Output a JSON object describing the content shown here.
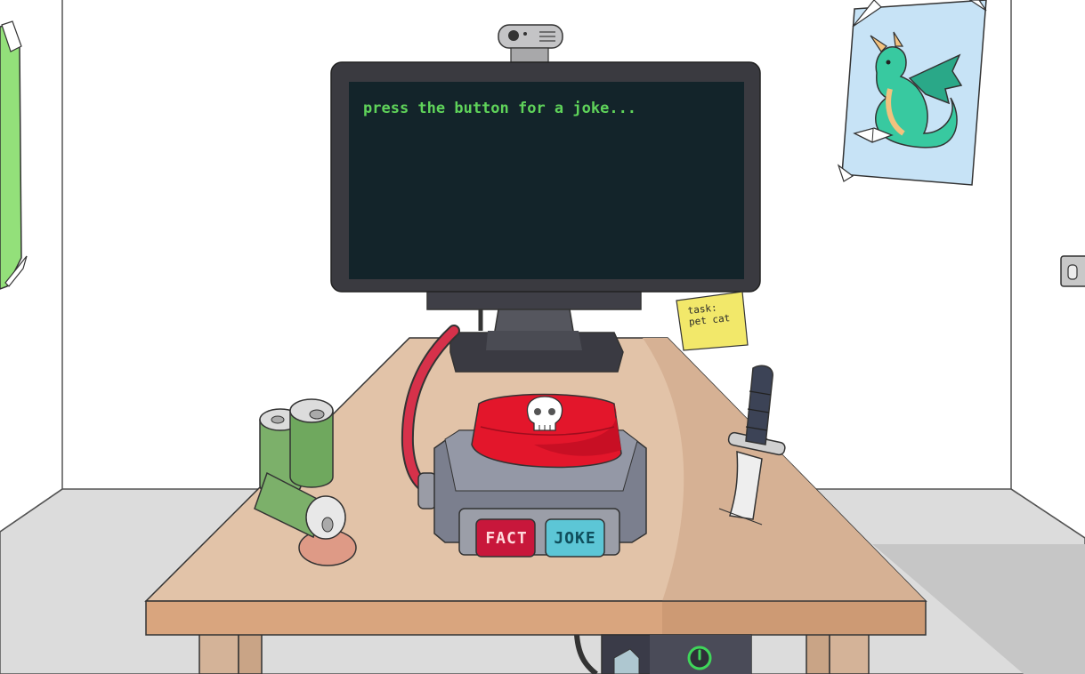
{
  "monitor": {
    "text": "press the button for a joke..."
  },
  "sticky_note": {
    "text": "task:\npet cat"
  },
  "console": {
    "fact_label": "FACT",
    "joke_label": "JOKE"
  },
  "colors": {
    "wall": "#ffffff",
    "floor": "#dcdcdc",
    "desk_top": "#e2c3a8",
    "desk_edge": "#d9a57e",
    "screen": "#13242a",
    "monitor_frame": "#3a3a40",
    "terminal_text": "#5fd35a",
    "big_button": "#e3162b",
    "fact_button": "#c8173b",
    "joke_button": "#5cc6d6",
    "sticky_note": "#f2e86a",
    "power_icon": "#3fd65a"
  },
  "icons": [
    "webcam-icon",
    "skull-icon",
    "power-icon",
    "dragon-poster-icon",
    "knife-icon",
    "battery-icon"
  ]
}
